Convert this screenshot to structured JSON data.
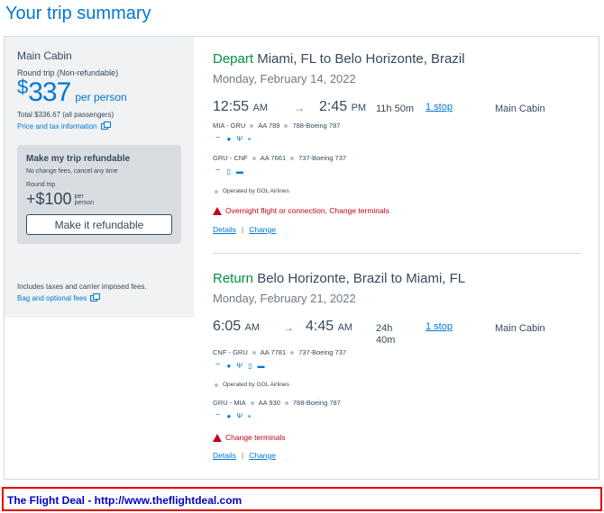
{
  "page": {
    "title": "Your trip summary"
  },
  "sidebar": {
    "cabin": "Main Cabin",
    "trip_type": "Round trip (Non-refundable)",
    "price_currency": "$",
    "price_amount": "337",
    "price_per": "per person",
    "total": "Total $336.67 (all passengers)",
    "price_tax_link": "Price and tax information",
    "refund": {
      "title": "Make my trip refundable",
      "subtitle": "No change fees, cancel any time",
      "trip_label": "Round trip",
      "plus": "+",
      "currency": "$",
      "amount": "100",
      "per_line1": "per",
      "per_line2": "person",
      "button_label": "Make it refundable"
    },
    "fees_text": "Includes taxes and carrier imposed fees.",
    "bag_link": "Bag and optional fees"
  },
  "depart": {
    "direction": "Depart",
    "route": "Miami, FL to Belo Horizonte, Brazil",
    "date": "Monday, February 14, 2022",
    "dep_time": "12:55",
    "dep_ampm": "AM",
    "arrow": "→",
    "arr_time": "2:45",
    "arr_ampm": "PM",
    "duration": "11h 50m",
    "stops": "1 stop",
    "cabin": "Main Cabin",
    "flights": [
      {
        "route": "MIA - GRU",
        "flight": "AA 789",
        "aircraft": "788-Boeing 787"
      },
      {
        "route": "GRU - CNF",
        "flight": "AA 7661",
        "aircraft": "737-Boeing 737"
      }
    ],
    "operated_by": "Operated by GOL Airlines",
    "warning": "Overnight flight or connection, Change terminals",
    "details_link": "Details",
    "change_link": "Change",
    "separator": "|"
  },
  "return": {
    "direction": "Return",
    "route": "Belo Horizonte, Brazil to Miami, FL",
    "date": "Monday, February 21, 2022",
    "dep_time": "6:05",
    "dep_ampm": "AM",
    "arrow": "→",
    "arr_time": "4:45",
    "arr_ampm": "AM",
    "duration_h": "24h",
    "duration_m": "40m",
    "stops": "1 stop",
    "cabin": "Main Cabin",
    "flights": [
      {
        "route": "CNF - GRU",
        "flight": "AA 7781",
        "aircraft": "737-Boeing 737"
      },
      {
        "route": "GRU - MIA",
        "flight": "AA 930",
        "aircraft": "788-Boeing 787"
      }
    ],
    "operated_by": "Operated by GOL Airlines",
    "warning": "Change terminals",
    "details_link": "Details",
    "change_link": "Change",
    "separator": "|"
  },
  "amenity_icons": [
    "wifi-icon",
    "power-icon",
    "usb-icon",
    "entertainment-icon",
    "tv-icon",
    "phone-icon"
  ],
  "footer": {
    "text": "The Flight Deal - http://www.theflightdeal.com"
  },
  "colors": {
    "accent": "#0078d2",
    "depart_green": "#00923f",
    "warning_red": "#c30019",
    "footer_border": "#e00000"
  }
}
